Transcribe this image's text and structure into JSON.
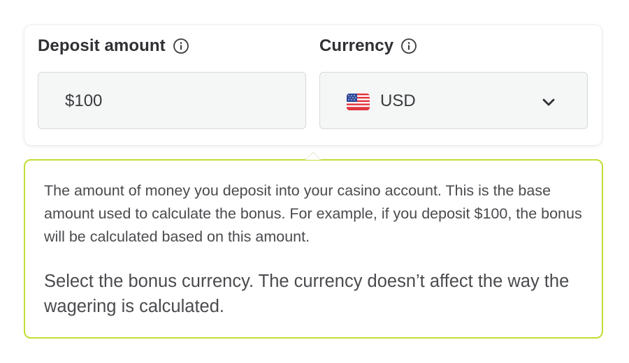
{
  "deposit": {
    "label": "Deposit amount",
    "value": "$100",
    "info_icon": "info-icon"
  },
  "currency": {
    "label": "Currency",
    "selected": "USD",
    "flag_icon": "us-flag-icon",
    "dropdown_icon": "chevron-down-icon",
    "info_icon": "info-icon"
  },
  "tooltip": {
    "deposit_help": "The amount of money you deposit into your casino account. This is the base amount used to calculate the bonus. For example, if you deposit $100, the bonus will be calculated based on this amount.",
    "currency_help": "Select the bonus currency. The currency doesn’t affect the way the wagering is calculated."
  },
  "colors": {
    "tooltip_border": "#c3dc34",
    "input_background": "#f5f6f6",
    "input_border": "#d6d9dc",
    "label_text": "#2f3033",
    "body_text": "#4a4b4e"
  }
}
